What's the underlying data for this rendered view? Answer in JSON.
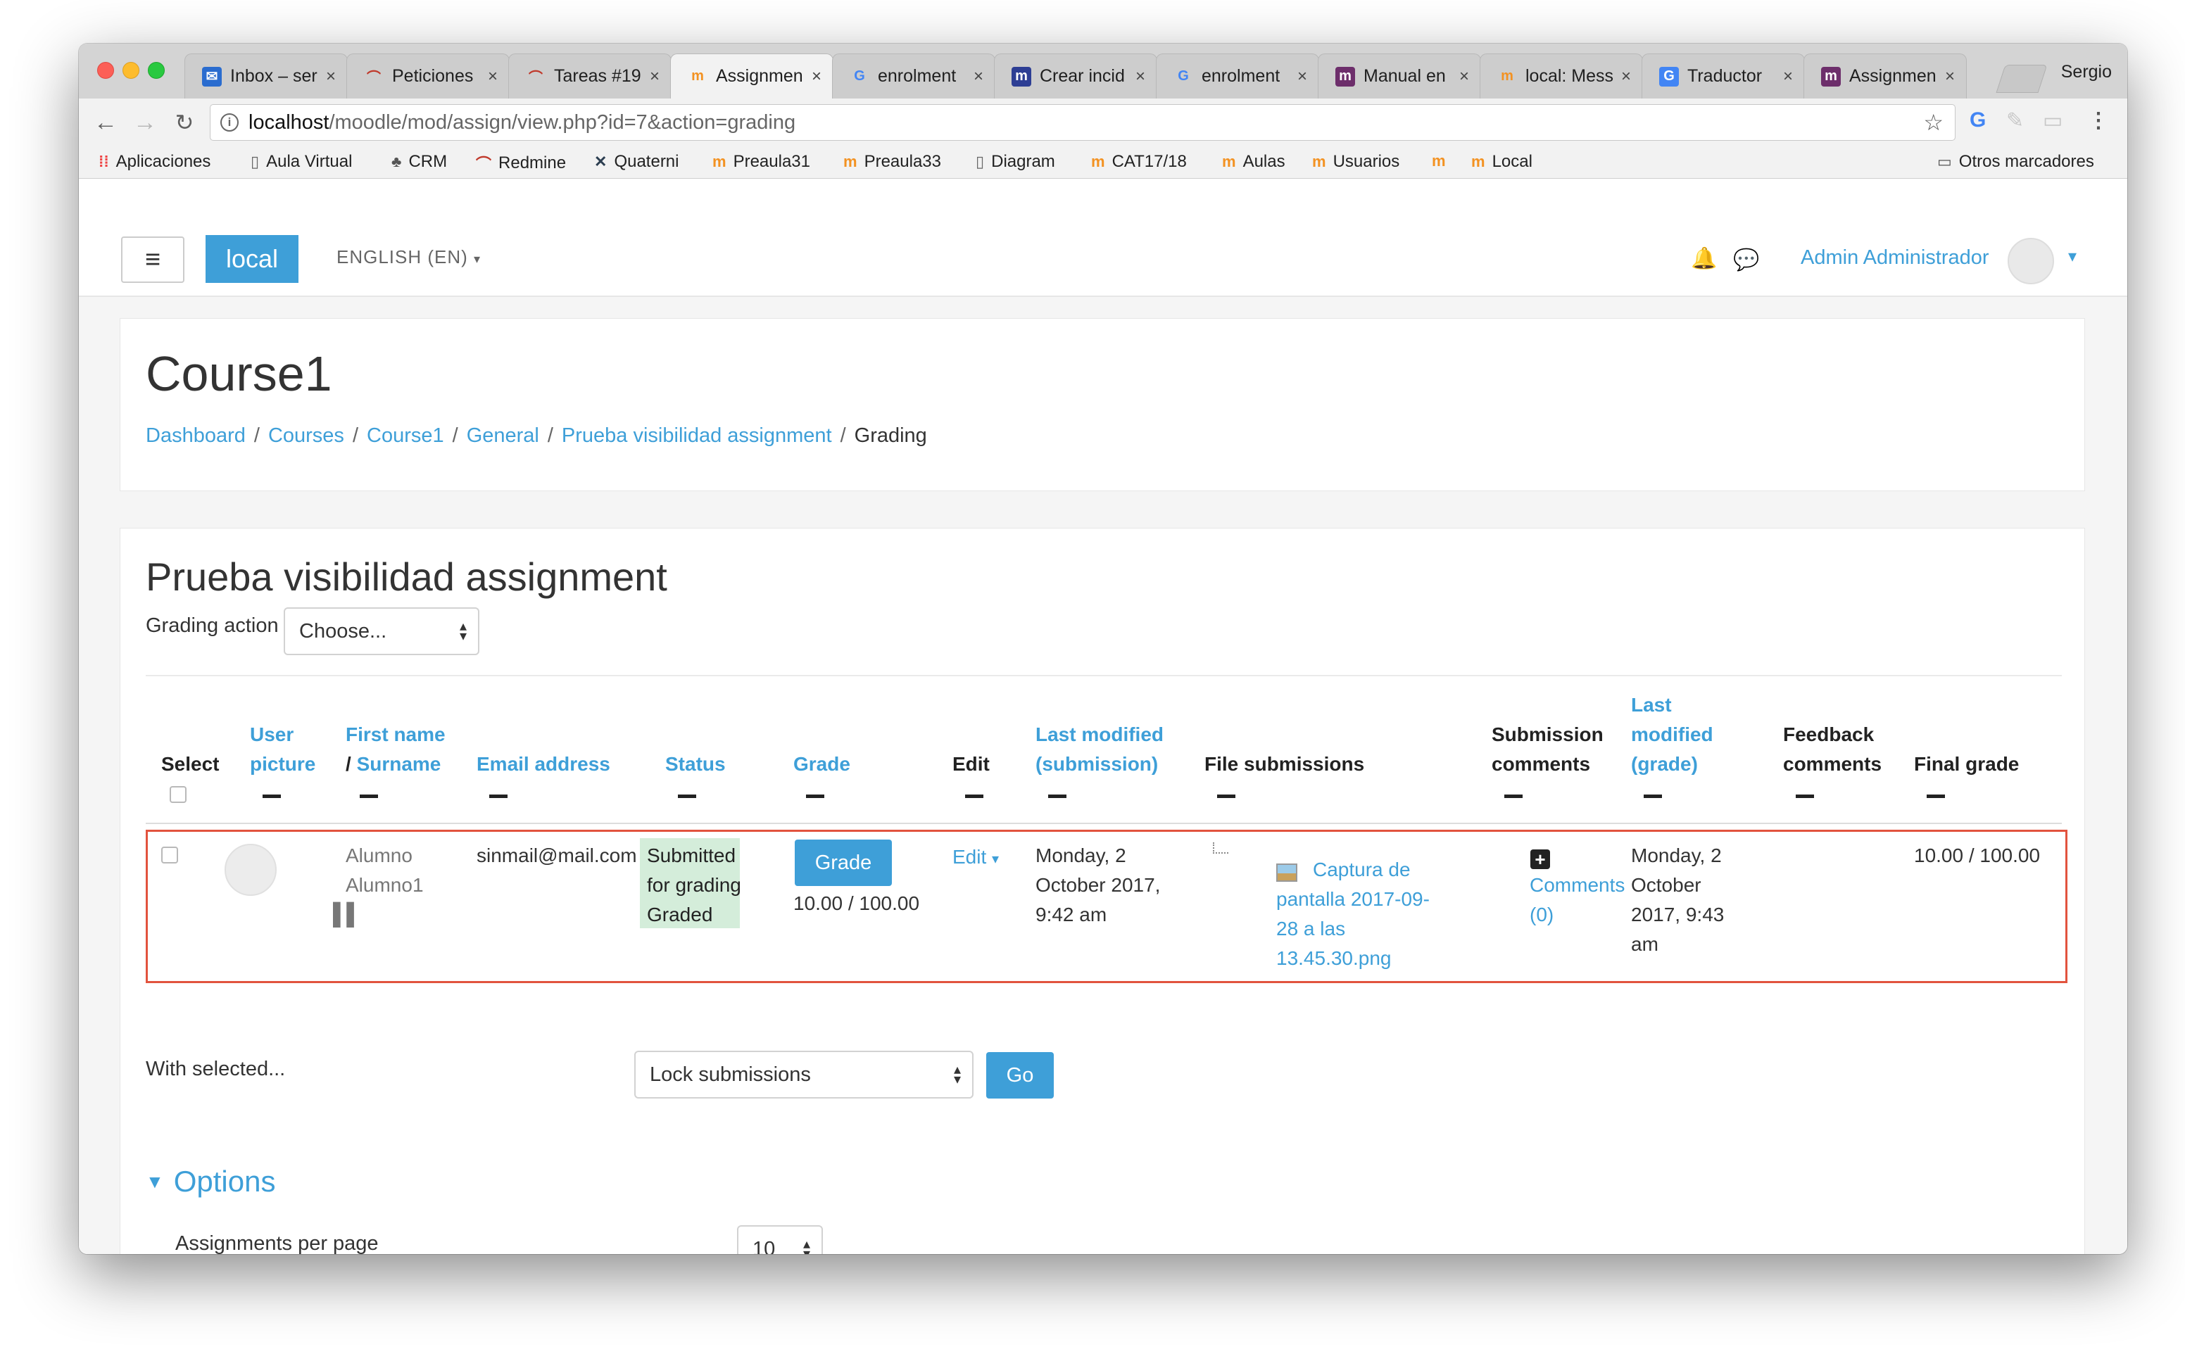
{
  "browser": {
    "tabs": [
      {
        "label": "Inbox – ser",
        "icon": "mail-icon",
        "active": false
      },
      {
        "label": "Peticiones",
        "icon": "redmine-icon",
        "active": false
      },
      {
        "label": "Tareas #19",
        "icon": "redmine-icon",
        "active": false
      },
      {
        "label": "Assignmen",
        "icon": "moodle-icon",
        "active": true
      },
      {
        "label": "enrolment",
        "icon": "google-icon",
        "active": false
      },
      {
        "label": "Crear incid",
        "icon": "moodle-tracker-icon",
        "active": false
      },
      {
        "label": "enrolment",
        "icon": "google-icon",
        "active": false
      },
      {
        "label": "Manual en",
        "icon": "moodle-tracker-icon",
        "active": false
      },
      {
        "label": "local: Mess",
        "icon": "moodle-icon",
        "active": false
      },
      {
        "label": "Traductor",
        "icon": "translate-icon",
        "active": false
      },
      {
        "label": "Assignmen",
        "icon": "moodle-tracker-icon",
        "active": false
      }
    ],
    "profile": "Sergio",
    "url_host": "localhost",
    "url_path": "/moodle/mod/assign/view.php?id=7&action=grading",
    "bookmarks": [
      "Aplicaciones",
      "Aula Virtual",
      "CRM",
      "Redmine",
      "Quaterni",
      "Preaula31",
      "Preaula33",
      "Diagram",
      "CAT17/18",
      "Aulas",
      "Usuarios",
      "",
      "Local"
    ],
    "other_bookmarks": "Otros marcadores"
  },
  "navbar": {
    "brand": "local",
    "language": "ENGLISH (EN)",
    "user": "Admin Administrador"
  },
  "course": {
    "title": "Course1",
    "breadcrumb": [
      "Dashboard",
      "Courses",
      "Course1",
      "General",
      "Prueba visibilidad assignment"
    ],
    "breadcrumb_current": "Grading"
  },
  "assignment": {
    "title": "Prueba visibilidad assignment",
    "grading_action_label": "Grading action",
    "grading_action_value": "Choose...",
    "columns": {
      "select": "Select",
      "user_picture_1": "User",
      "user_picture_2": "picture",
      "first_name": "First name",
      "slash": "/ ",
      "surname": "Surname",
      "email": "Email address",
      "status": "Status",
      "grade": "Grade",
      "edit": "Edit",
      "last_modified_sub_1": "Last modified",
      "last_modified_sub_2": "(submission)",
      "file_submissions": "File submissions",
      "submission_comments_1": "Submission",
      "submission_comments_2": "comments",
      "last_modified_grade_1": "Last",
      "last_modified_grade_2": "modified",
      "last_modified_grade_3": "(grade)",
      "feedback_1": "Feedback",
      "feedback_2": "comments",
      "final_grade": "Final grade"
    },
    "row": {
      "name_1": "Alumno",
      "name_2": "Alumno1",
      "email": "sinmail@mail.com",
      "status_1": "Submitted",
      "status_2": "for grading",
      "status_3": "Graded",
      "grade_button": "Grade",
      "grade_value": "10.00 / 100.00",
      "edit": "Edit",
      "modified_1": "Monday, 2",
      "modified_2": "October 2017,",
      "modified_3": "9:42 am",
      "file_1": "Captura de",
      "file_2": "pantalla 2017-09-",
      "file_3": "28 a las",
      "file_4": "13.45.30.png",
      "comments_1": "Comments",
      "comments_2": "(0)",
      "grade_modified_1": "Monday, 2",
      "grade_modified_2": "October",
      "grade_modified_3": "2017, 9:43",
      "grade_modified_4": "am",
      "final_grade": "10.00 / 100.00"
    },
    "with_selected_label": "With selected...",
    "with_selected_value": "Lock submissions",
    "go_button": "Go",
    "options_label": "Options",
    "per_page_label": "Assignments per page",
    "per_page_value": "10"
  },
  "colors": {
    "link": "#3e9fd8",
    "highlight_border": "#e2533e",
    "status_bg": "#d4edda"
  }
}
